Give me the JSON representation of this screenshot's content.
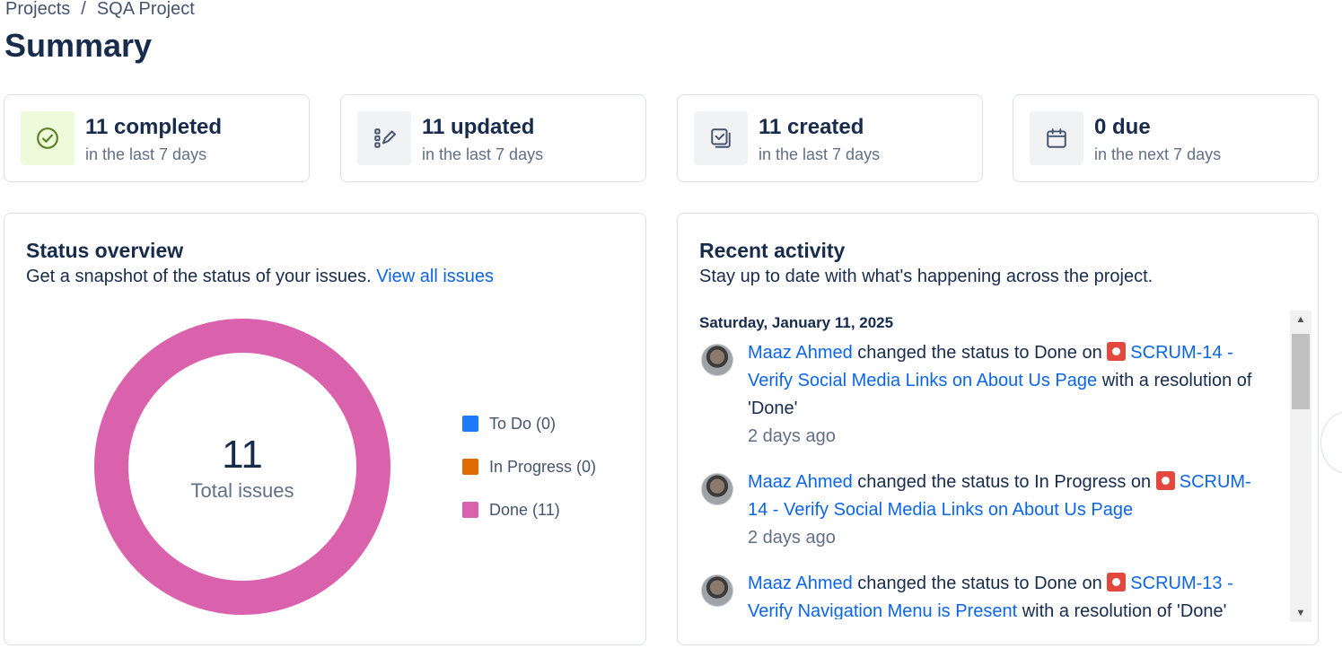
{
  "breadcrumb": {
    "projects": "Projects",
    "separator": "/",
    "project": "SQA Project"
  },
  "page_title": "Summary",
  "stats": [
    {
      "title": "11 completed",
      "subtitle": "in the last 7 days",
      "icon": "check-circle-icon",
      "icon_color": "#5b7f24"
    },
    {
      "title": "11 updated",
      "subtitle": "in the last 7 days",
      "icon": "edit-list-icon",
      "icon_color": "#44546f"
    },
    {
      "title": "11 created",
      "subtitle": "in the last 7 days",
      "icon": "created-copy-icon",
      "icon_color": "#44546f"
    },
    {
      "title": "0 due",
      "subtitle": "in the next 7 days",
      "icon": "calendar-icon",
      "icon_color": "#44546f"
    }
  ],
  "status_overview": {
    "title": "Status overview",
    "description": "Get a snapshot of the status of your issues.",
    "link": "View all issues",
    "total": "11",
    "total_label": "Total issues",
    "legend": [
      {
        "label": "To Do (0)",
        "color": "#1d7afc"
      },
      {
        "label": "In Progress (0)",
        "color": "#e06c00"
      },
      {
        "label": "Done (11)",
        "color": "#da62ac"
      }
    ]
  },
  "chart_data": {
    "type": "pie",
    "categories": [
      "To Do",
      "In Progress",
      "Done"
    ],
    "values": [
      0,
      0,
      11
    ],
    "title": "",
    "colors": [
      "#1d7afc",
      "#e06c00",
      "#da62ac"
    ]
  },
  "recent_activity": {
    "title": "Recent activity",
    "description": "Stay up to date with what's happening across the project.",
    "date": "Saturday, January 11, 2025",
    "items": [
      {
        "user": "Maaz Ahmed",
        "action": "changed the status to Done on",
        "issue": "SCRUM-14 - Verify Social Media Links on About Us Page",
        "suffix": "with a resolution of 'Done'",
        "time": "2 days ago"
      },
      {
        "user": "Maaz Ahmed",
        "action": "changed the status to In Progress on",
        "issue": "SCRUM-14 - Verify Social Media Links on About Us Page",
        "suffix": "",
        "time": "2 days ago"
      },
      {
        "user": "Maaz Ahmed",
        "action": "changed the status to Done on",
        "issue": "SCRUM-13 - Verify Navigation Menu is Present",
        "suffix": "with a resolution of 'Done'",
        "time": ""
      }
    ]
  }
}
